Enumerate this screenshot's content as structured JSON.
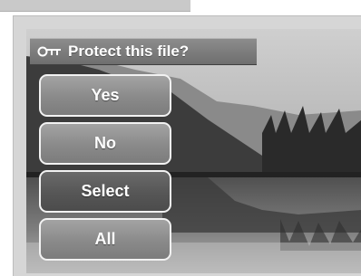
{
  "dialog": {
    "title": "Protect this file?",
    "icon": "key-icon"
  },
  "menu": {
    "items": [
      {
        "label": "Yes",
        "selected": false
      },
      {
        "label": "No",
        "selected": false
      },
      {
        "label": "Select",
        "selected": true
      },
      {
        "label": "All",
        "selected": false
      }
    ]
  },
  "colors": {
    "button_normal": "#8f8f8f",
    "button_selected": "#565656",
    "title_bar": "#7a7a7a",
    "text": "#ffffff"
  }
}
